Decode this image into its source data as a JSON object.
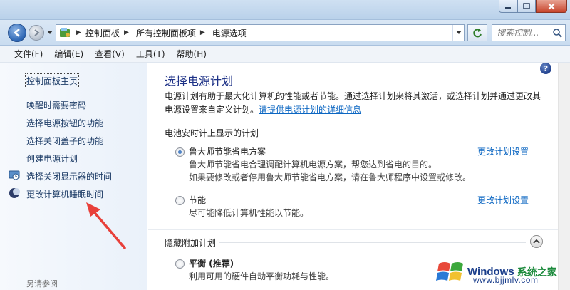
{
  "window": {
    "controls": [
      "minimize",
      "maximize",
      "close"
    ]
  },
  "address_bar": {
    "breadcrumbs": [
      "控制面板",
      "所有控制面板项",
      "电源选项"
    ],
    "search_placeholder": "搜索控制..."
  },
  "menu": {
    "items": [
      "文件(F)",
      "编辑(E)",
      "查看(V)",
      "工具(T)",
      "帮助(H)"
    ]
  },
  "left_pane": {
    "home": "控制面板主页",
    "links": [
      "唤醒时需要密码",
      "选择电源按钮的功能",
      "选择关闭盖子的功能",
      "创建电源计划",
      "选择关闭显示器的时间",
      "更改计算机睡眠时间"
    ],
    "footer": "另请参阅"
  },
  "main": {
    "title": "选择电源计划",
    "intro_line1": "电源计划有助于最大化计算机的性能或者节能。通过选择计划来将其激活，或选择计划并通过更改其",
    "intro_line2": "电源设置来自定义计划。",
    "intro_link": "请提供电源计划的详细信息",
    "section_battery": "电池安时计上显示的计划",
    "plans": [
      {
        "name": "鲁大师节能省电方案",
        "desc_line1": "鲁大师节能省电合理调配计算机电源方案，帮您达到省电的目的。",
        "desc_line2": "如果要修改或者停用鲁大师节能省电方案，请在鲁大师程序中设置或修改。",
        "link": "更改计划设置",
        "selected": true
      },
      {
        "name": "节能",
        "desc_line1": "尽可能降低计算机性能以节能。",
        "link": "更改计划设置",
        "selected": false
      }
    ],
    "section_hidden": "隐藏附加计划",
    "hidden_plan": {
      "name": "平衡 (推荐)",
      "desc_line1": "利用可用的硬件自动平衡功耗与性能。",
      "selected": false
    }
  },
  "watermark": {
    "brand": "Windows",
    "site": "系统之家",
    "url": "www.bjjmlv.com"
  },
  "colors": {
    "accent_link": "#0b66c2",
    "title_blue": "#1e3287",
    "annotation_arrow": "#e8403a"
  }
}
